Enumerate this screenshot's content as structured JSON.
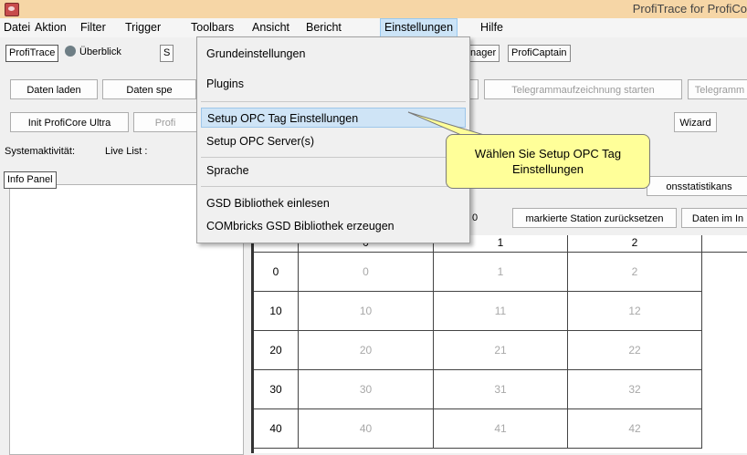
{
  "window": {
    "title": "ProfiTrace for ProfiCo"
  },
  "menubar": [
    "Datei",
    "Aktion",
    "Filter",
    "Trigger",
    "Toolbars",
    "Ansicht",
    "Bericht",
    "Einstellungen",
    "Hilfe"
  ],
  "tabs": {
    "proftrace": "ProfiTrace",
    "ueberblick": "Überblick",
    "s": "S",
    "manager": "nager",
    "proficaptain": "ProfiCaptain"
  },
  "buttons": {
    "daten_laden": "Daten laden",
    "daten_speichern": "Daten spe",
    "telegramm_start": "Telegrammaufzeichnung starten",
    "telegramm2": "Telegramm",
    "init_proficore": "Init ProfiCore Ultra",
    "profi": "Profi",
    "wizard": "Wizard",
    "stationsstatistik": "onsstatistikans",
    "reset_station": "markierte Station zurücksetzen",
    "daten_im": "Daten im In",
    "partial0": "0"
  },
  "status": {
    "systemaktivitaet": "Systemaktivität:",
    "live_list": "Live List :"
  },
  "info_panel": "Info Panel",
  "menu": {
    "items": [
      "Grundeinstellungen",
      "Plugins",
      "Setup OPC Tag Einstellungen",
      "Setup OPC Server(s)",
      "Sprache",
      "GSD Bibliothek einlesen",
      "COMbricks GSD Bibliothek erzeugen"
    ],
    "highlighted_index": 2
  },
  "callout": {
    "text": "Wählen Sie Setup OPC Tag Einstellungen"
  },
  "grid": {
    "columns": [
      "0",
      "1",
      "2"
    ],
    "rows": [
      {
        "head": "0",
        "cells": [
          "0",
          "1",
          "2"
        ]
      },
      {
        "head": "10",
        "cells": [
          "10",
          "11",
          "12"
        ]
      },
      {
        "head": "20",
        "cells": [
          "20",
          "21",
          "22"
        ]
      },
      {
        "head": "30",
        "cells": [
          "30",
          "31",
          "32"
        ]
      },
      {
        "head": "40",
        "cells": [
          "40",
          "41",
          "42"
        ]
      }
    ]
  },
  "colors": {
    "titlebar": "#f6d6a6",
    "menu_highlight": "#cfe4f6",
    "callout": "#ffff99"
  }
}
